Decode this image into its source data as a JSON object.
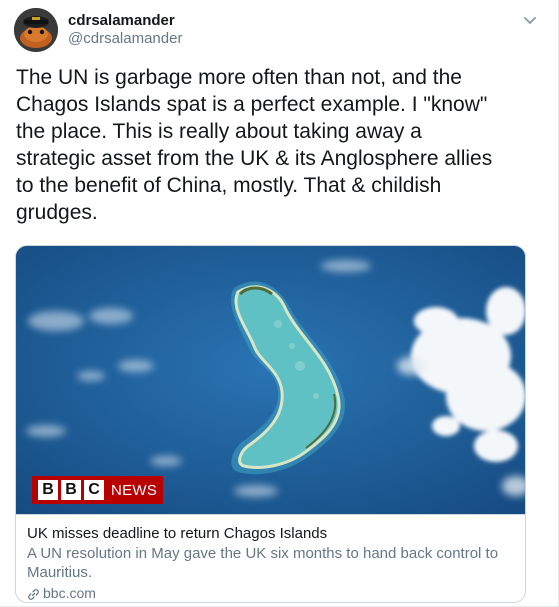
{
  "author": {
    "display_name": "cdrsalamander",
    "handle": "@cdrsalamander",
    "avatar_icon": "salamander-avatar-icon"
  },
  "menu": {
    "caret_icon": "chevron-down-icon"
  },
  "tweet": {
    "text": "The UN is garbage more often than not, and the\nChagos Islands spat is a perfect example. I \"know\"\nthe place. This is really about taking away a\nstrategic asset from the UK & its Anglosphere allies\nto the benefit of China, mostly. That & childish\ngrudges."
  },
  "card": {
    "image_icon": "atoll-satellite-image",
    "logo": {
      "letters": [
        "B",
        "B",
        "C"
      ],
      "suffix": "NEWS",
      "color": "#b80000"
    },
    "title": "UK misses deadline to return Chagos Islands",
    "description": "A UN resolution in May gave the UK six months to hand back control to\nMauritius.",
    "domain": "bbc.com",
    "domain_icon": "link-icon"
  },
  "colors": {
    "text_primary": "#14171a",
    "text_secondary": "#657786",
    "border": "#ccd6dd",
    "ocean": "#1d5f9e",
    "lagoon": "#5fc1c4"
  }
}
